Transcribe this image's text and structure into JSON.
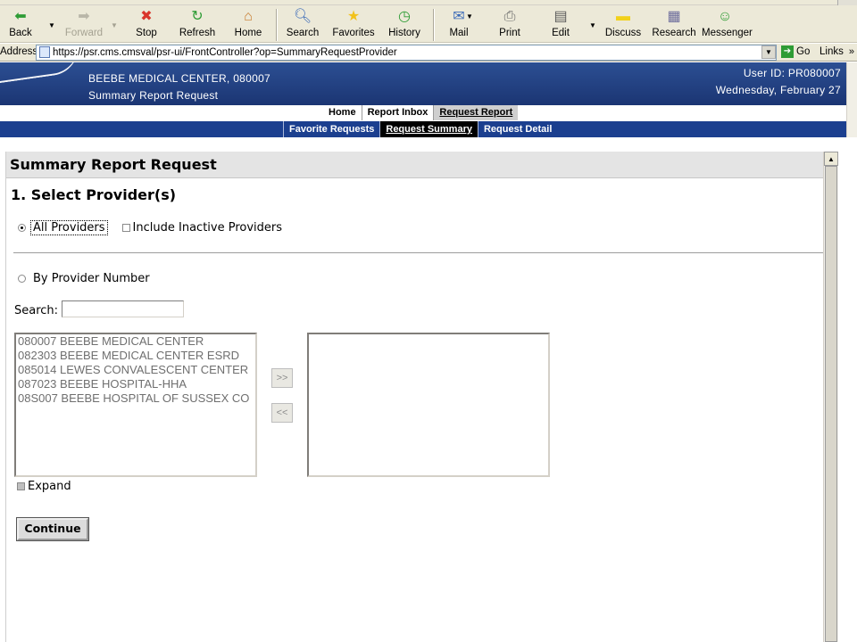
{
  "browser": {
    "toolbar": [
      {
        "label": "Back",
        "icon": "back-arrow-icon",
        "color": "#2e9c35"
      },
      {
        "label": "Forward",
        "icon": "forward-arrow-icon",
        "disabled": true
      },
      {
        "label": "Stop",
        "icon": "stop-icon",
        "color": "#d9352b"
      },
      {
        "label": "Refresh",
        "icon": "refresh-icon",
        "color": "#2e9c35"
      },
      {
        "label": "Home",
        "icon": "home-icon"
      },
      {
        "label": "Search",
        "icon": "search-icon"
      },
      {
        "label": "Favorites",
        "icon": "favorites-star-icon",
        "color": "#f2c21b"
      },
      {
        "label": "History",
        "icon": "history-icon",
        "color": "#2e9c35"
      },
      {
        "label": "Mail",
        "icon": "mail-icon"
      },
      {
        "label": "Print",
        "icon": "print-icon"
      },
      {
        "label": "Edit",
        "icon": "edit-icon"
      },
      {
        "label": "Discuss",
        "icon": "discuss-icon",
        "color": "#f2d11b"
      },
      {
        "label": "Research",
        "icon": "research-icon"
      },
      {
        "label": "Messenger",
        "icon": "messenger-icon",
        "color": "#2e9c35"
      }
    ],
    "address_label": "Address",
    "url": "https://psr.cms.cmsval/psr-ui/FrontController?op=SummaryRequestProvider",
    "go_label": "Go",
    "links_label": "Links",
    "links_more": "»"
  },
  "header": {
    "org": "BEEBE MEDICAL CENTER, 080007",
    "subtitle": "Summary Report Request",
    "user": "User ID: PR080007",
    "date": "Wednesday, February 27"
  },
  "nav_top": [
    {
      "label": "Home",
      "active": false
    },
    {
      "label": "Report Inbox",
      "active": false
    },
    {
      "label": "Request Report",
      "active": true
    }
  ],
  "nav_sub": [
    {
      "label": "Favorite Requests",
      "active": false
    },
    {
      "label": "Request Summary",
      "active": true
    },
    {
      "label": "Request Detail",
      "active": false
    }
  ],
  "main": {
    "section_title": "Summary Report Request",
    "step_title": "1.  Select Provider(s)",
    "all_providers_label": "All Providers",
    "include_inactive_label": "Include Inactive Providers",
    "by_number_label": "By Provider Number",
    "search_label": "Search:",
    "search_value": "",
    "available_providers": [
      "080007 BEEBE MEDICAL CENTER",
      "082303 BEEBE MEDICAL CENTER ESRD",
      "085014 LEWES CONVALESCENT CENTER",
      "087023 BEEBE HOSPITAL-HHA",
      "08S007 BEEBE HOSPITAL OF SUSSEX CO"
    ],
    "selected_providers": [],
    "add_label": ">>",
    "remove_label": "<<",
    "expand_label": "Expand",
    "continue_label": "Continue"
  },
  "colors": {
    "header_blue": "#1b3573",
    "subnav_blue": "#1b3f8f",
    "active_tab": "#cfcfcf"
  }
}
